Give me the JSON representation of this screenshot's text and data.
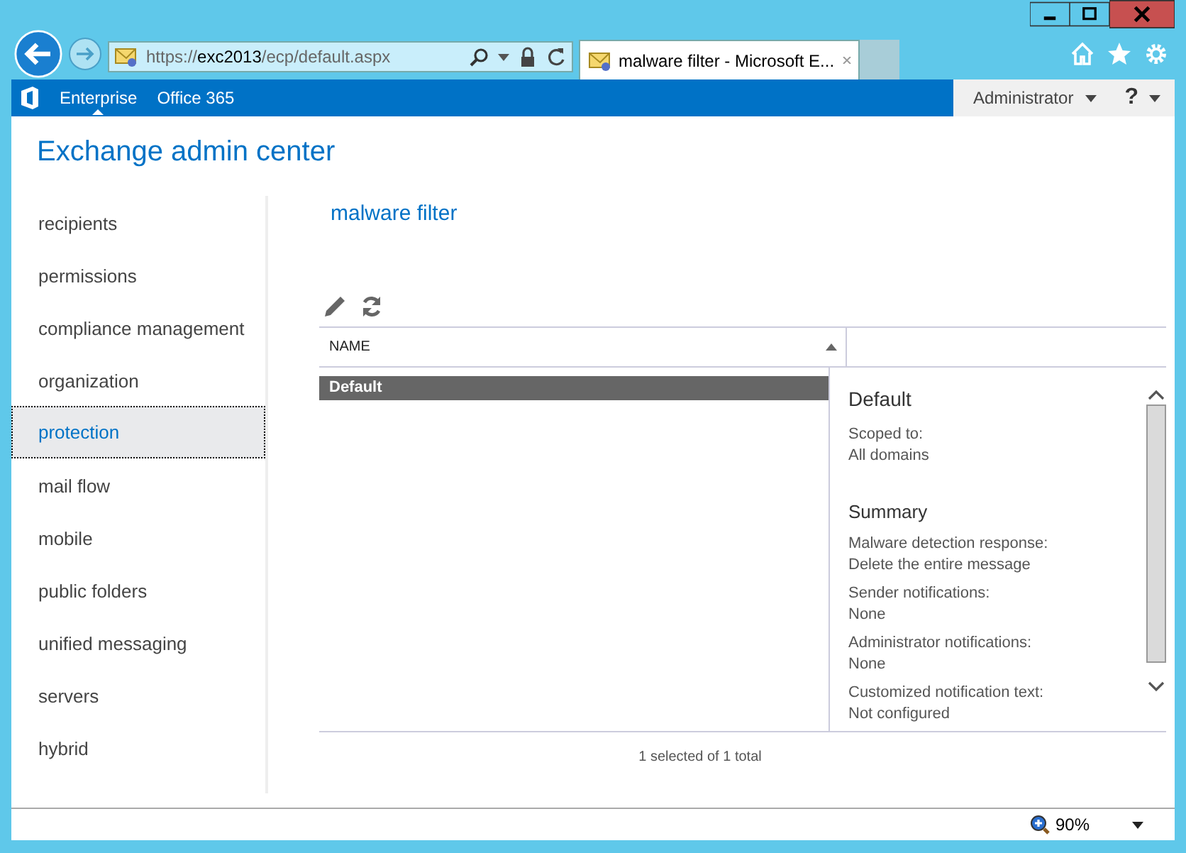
{
  "browser": {
    "url_host": "exc2013",
    "url_scheme": "https://",
    "url_path": "/ecp/default.aspx",
    "tab_title": "malware filter - Microsoft E...",
    "zoom": "90%"
  },
  "nav": {
    "items": [
      {
        "label": "Enterprise",
        "selected": true
      },
      {
        "label": "Office 365",
        "selected": false
      }
    ],
    "user": "Administrator",
    "help": "?"
  },
  "app_title": "Exchange admin center",
  "sidebar": {
    "items": [
      {
        "label": "recipients",
        "selected": false
      },
      {
        "label": "permissions",
        "selected": false
      },
      {
        "label": "compliance management",
        "selected": false
      },
      {
        "label": "organization",
        "selected": false
      },
      {
        "label": "protection",
        "selected": true
      },
      {
        "label": "mail flow",
        "selected": false
      },
      {
        "label": "mobile",
        "selected": false
      },
      {
        "label": "public folders",
        "selected": false
      },
      {
        "label": "unified messaging",
        "selected": false
      },
      {
        "label": "servers",
        "selected": false
      },
      {
        "label": "hybrid",
        "selected": false
      }
    ]
  },
  "page_title": "malware filter",
  "table": {
    "columns": [
      "NAME"
    ],
    "rows": [
      {
        "name": "Default",
        "selected": true
      }
    ],
    "footer": "1 selected of 1 total"
  },
  "details": {
    "title": "Default",
    "fields": [
      {
        "label": "Scoped to:",
        "value": "All domains"
      }
    ],
    "summary_heading": "Summary",
    "summary": [
      {
        "label": "Malware detection response:",
        "value": "Delete the entire message"
      },
      {
        "label": "Sender notifications:",
        "value": "None"
      },
      {
        "label": "Administrator notifications:",
        "value": "None"
      },
      {
        "label": "Customized notification text:",
        "value": "Not configured"
      }
    ]
  }
}
